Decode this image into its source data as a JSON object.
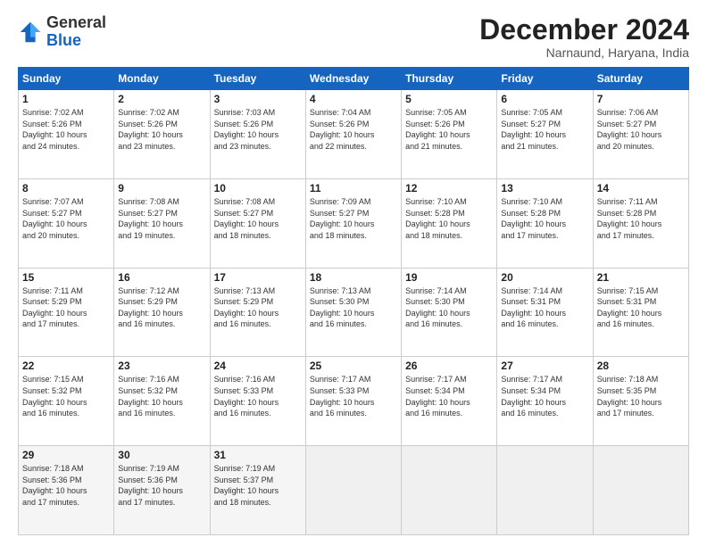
{
  "logo": {
    "general": "General",
    "blue": "Blue"
  },
  "header": {
    "month": "December 2024",
    "location": "Narnaund, Haryana, India"
  },
  "weekdays": [
    "Sunday",
    "Monday",
    "Tuesday",
    "Wednesday",
    "Thursday",
    "Friday",
    "Saturday"
  ],
  "weeks": [
    [
      {
        "day": "1",
        "info": "Sunrise: 7:02 AM\nSunset: 5:26 PM\nDaylight: 10 hours\nand 24 minutes."
      },
      {
        "day": "2",
        "info": "Sunrise: 7:02 AM\nSunset: 5:26 PM\nDaylight: 10 hours\nand 23 minutes."
      },
      {
        "day": "3",
        "info": "Sunrise: 7:03 AM\nSunset: 5:26 PM\nDaylight: 10 hours\nand 23 minutes."
      },
      {
        "day": "4",
        "info": "Sunrise: 7:04 AM\nSunset: 5:26 PM\nDaylight: 10 hours\nand 22 minutes."
      },
      {
        "day": "5",
        "info": "Sunrise: 7:05 AM\nSunset: 5:26 PM\nDaylight: 10 hours\nand 21 minutes."
      },
      {
        "day": "6",
        "info": "Sunrise: 7:05 AM\nSunset: 5:27 PM\nDaylight: 10 hours\nand 21 minutes."
      },
      {
        "day": "7",
        "info": "Sunrise: 7:06 AM\nSunset: 5:27 PM\nDaylight: 10 hours\nand 20 minutes."
      }
    ],
    [
      {
        "day": "8",
        "info": "Sunrise: 7:07 AM\nSunset: 5:27 PM\nDaylight: 10 hours\nand 20 minutes."
      },
      {
        "day": "9",
        "info": "Sunrise: 7:08 AM\nSunset: 5:27 PM\nDaylight: 10 hours\nand 19 minutes."
      },
      {
        "day": "10",
        "info": "Sunrise: 7:08 AM\nSunset: 5:27 PM\nDaylight: 10 hours\nand 18 minutes."
      },
      {
        "day": "11",
        "info": "Sunrise: 7:09 AM\nSunset: 5:27 PM\nDaylight: 10 hours\nand 18 minutes."
      },
      {
        "day": "12",
        "info": "Sunrise: 7:10 AM\nSunset: 5:28 PM\nDaylight: 10 hours\nand 18 minutes."
      },
      {
        "day": "13",
        "info": "Sunrise: 7:10 AM\nSunset: 5:28 PM\nDaylight: 10 hours\nand 17 minutes."
      },
      {
        "day": "14",
        "info": "Sunrise: 7:11 AM\nSunset: 5:28 PM\nDaylight: 10 hours\nand 17 minutes."
      }
    ],
    [
      {
        "day": "15",
        "info": "Sunrise: 7:11 AM\nSunset: 5:29 PM\nDaylight: 10 hours\nand 17 minutes."
      },
      {
        "day": "16",
        "info": "Sunrise: 7:12 AM\nSunset: 5:29 PM\nDaylight: 10 hours\nand 16 minutes."
      },
      {
        "day": "17",
        "info": "Sunrise: 7:13 AM\nSunset: 5:29 PM\nDaylight: 10 hours\nand 16 minutes."
      },
      {
        "day": "18",
        "info": "Sunrise: 7:13 AM\nSunset: 5:30 PM\nDaylight: 10 hours\nand 16 minutes."
      },
      {
        "day": "19",
        "info": "Sunrise: 7:14 AM\nSunset: 5:30 PM\nDaylight: 10 hours\nand 16 minutes."
      },
      {
        "day": "20",
        "info": "Sunrise: 7:14 AM\nSunset: 5:31 PM\nDaylight: 10 hours\nand 16 minutes."
      },
      {
        "day": "21",
        "info": "Sunrise: 7:15 AM\nSunset: 5:31 PM\nDaylight: 10 hours\nand 16 minutes."
      }
    ],
    [
      {
        "day": "22",
        "info": "Sunrise: 7:15 AM\nSunset: 5:32 PM\nDaylight: 10 hours\nand 16 minutes."
      },
      {
        "day": "23",
        "info": "Sunrise: 7:16 AM\nSunset: 5:32 PM\nDaylight: 10 hours\nand 16 minutes."
      },
      {
        "day": "24",
        "info": "Sunrise: 7:16 AM\nSunset: 5:33 PM\nDaylight: 10 hours\nand 16 minutes."
      },
      {
        "day": "25",
        "info": "Sunrise: 7:17 AM\nSunset: 5:33 PM\nDaylight: 10 hours\nand 16 minutes."
      },
      {
        "day": "26",
        "info": "Sunrise: 7:17 AM\nSunset: 5:34 PM\nDaylight: 10 hours\nand 16 minutes."
      },
      {
        "day": "27",
        "info": "Sunrise: 7:17 AM\nSunset: 5:34 PM\nDaylight: 10 hours\nand 16 minutes."
      },
      {
        "day": "28",
        "info": "Sunrise: 7:18 AM\nSunset: 5:35 PM\nDaylight: 10 hours\nand 17 minutes."
      }
    ],
    [
      {
        "day": "29",
        "info": "Sunrise: 7:18 AM\nSunset: 5:36 PM\nDaylight: 10 hours\nand 17 minutes."
      },
      {
        "day": "30",
        "info": "Sunrise: 7:19 AM\nSunset: 5:36 PM\nDaylight: 10 hours\nand 17 minutes."
      },
      {
        "day": "31",
        "info": "Sunrise: 7:19 AM\nSunset: 5:37 PM\nDaylight: 10 hours\nand 18 minutes."
      },
      {
        "day": "",
        "info": ""
      },
      {
        "day": "",
        "info": ""
      },
      {
        "day": "",
        "info": ""
      },
      {
        "day": "",
        "info": ""
      }
    ]
  ]
}
